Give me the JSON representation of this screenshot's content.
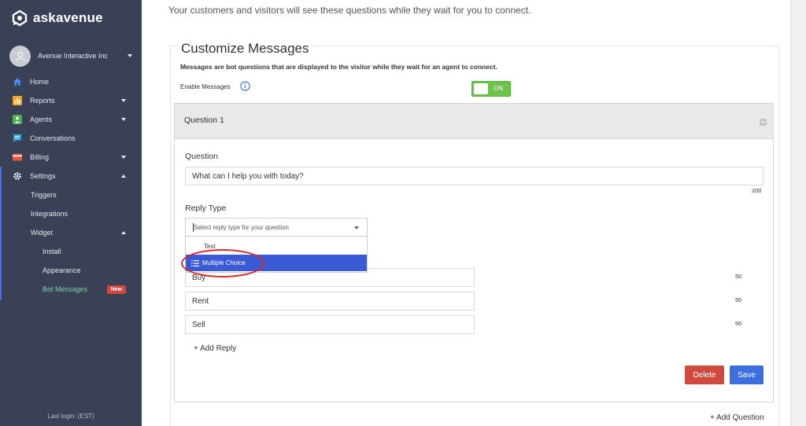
{
  "brand": {
    "name": "askavenue"
  },
  "account": {
    "name": "Avenue Interactive Inc"
  },
  "nav": {
    "home": "Home",
    "reports": "Reports",
    "agents": "Agents",
    "conversations": "Conversations",
    "billing": "Billing",
    "settings": "Settings",
    "triggers": "Triggers",
    "integrations": "Integrations",
    "widget": "Widget",
    "install": "Install",
    "appearance": "Appearance",
    "bot_messages": "Bot Messages",
    "new_badge": "New"
  },
  "footer": {
    "last_login": "Last login: (EST)"
  },
  "main": {
    "intro": "Your customers and visitors will see these questions while they wait for you to connect.",
    "section_title": "Customize Messages",
    "section_desc": "Messages are bot questions that are displayed to the visitor while they wait for an agent to connect.",
    "enable_label": "Enable Messages",
    "toggle_state": "ON",
    "question_panel_title": "Question 1",
    "question_label": "Question",
    "question_value": "What can I help you with today?",
    "question_counter": "200",
    "reply_type_label": "Reply Type",
    "reply_type_placeholder": "Select reply type for your question",
    "options": [
      "Text",
      "Multiple Choice"
    ],
    "replies": [
      {
        "value": "Buy",
        "counter": "50"
      },
      {
        "value": "Rent",
        "counter": "50"
      },
      {
        "value": "Sell",
        "counter": "50"
      }
    ],
    "add_reply": "+ Add Reply",
    "delete_label": "Delete",
    "save_label": "Save",
    "add_question": "+ Add Question"
  },
  "colors": {
    "sidebar_bg": "#3a4156",
    "accent_blue": "#3b5bd6",
    "toggle_green": "#6cc24a",
    "delete_red": "#cf4a3c",
    "annotation_red": "#e02525"
  }
}
